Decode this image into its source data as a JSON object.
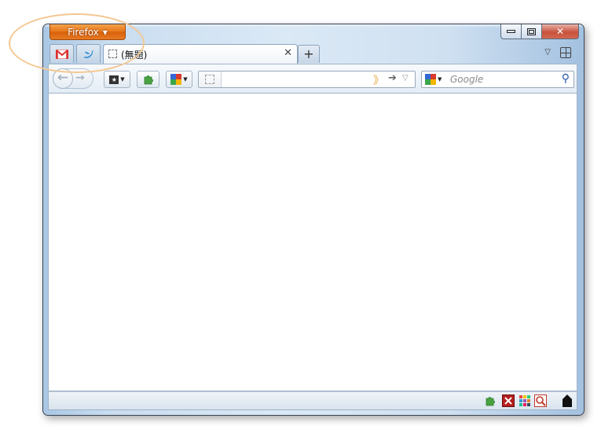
{
  "window": {
    "app_button_label": "Firefox",
    "caption": {
      "minimize": "minimize",
      "maximize": "maximize",
      "close": "close"
    }
  },
  "tabs": {
    "app_tabs": [
      {
        "site": "Gmail",
        "icon": "gmail-icon"
      },
      {
        "site": "Twitter",
        "icon": "twitter-icon"
      }
    ],
    "active_tab_title": "(無題)",
    "new_tab_label": "+"
  },
  "navbar": {
    "url_value": "",
    "search_placeholder": "Google"
  },
  "colors": {
    "accent_orange": "#e5761b",
    "annotation": "#f3c893",
    "frame": "#c9ddf0"
  },
  "statusbar_icons": [
    "addon-icon",
    "x-icon",
    "grid-icon",
    "search-box-icon",
    "black-shape-icon"
  ]
}
